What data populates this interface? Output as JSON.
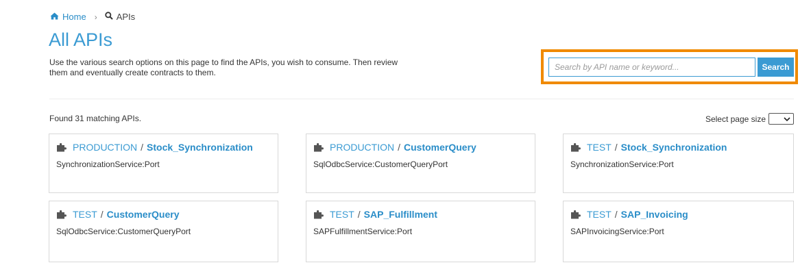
{
  "breadcrumb": {
    "home_label": "Home",
    "separator": "›",
    "current_label": "APIs"
  },
  "page": {
    "title": "All APIs",
    "description": "Use the various search options on this page to find the APIs, you wish to consume. Then review them and eventually create contracts to them."
  },
  "search": {
    "placeholder": "Search by API name or keyword...",
    "button_label": "Search",
    "highlight_color": "#f08a00"
  },
  "results": {
    "found_text": "Found 31 matching APIs.",
    "page_size_label": "Select page size"
  },
  "apis": [
    {
      "stage": "PRODUCTION",
      "name": "Stock_Synchronization",
      "port": "SynchronizationService:Port"
    },
    {
      "stage": "PRODUCTION",
      "name": "CustomerQuery",
      "port": "SqlOdbcService:CustomerQueryPort"
    },
    {
      "stage": "TEST",
      "name": "Stock_Synchronization",
      "port": "SynchronizationService:Port"
    },
    {
      "stage": "TEST",
      "name": "CustomerQuery",
      "port": "SqlOdbcService:CustomerQueryPort"
    },
    {
      "stage": "TEST",
      "name": "SAP_Fulfillment",
      "port": "SAPFulfillmentService:Port"
    },
    {
      "stage": "TEST",
      "name": "SAP_Invoicing",
      "port": "SAPInvoicingService:Port"
    }
  ],
  "colors": {
    "accent": "#3b9bd3",
    "link": "#2a8dc8"
  },
  "icons": {
    "home": "home-icon",
    "search": "search-icon",
    "api": "puzzle-piece-icon"
  }
}
